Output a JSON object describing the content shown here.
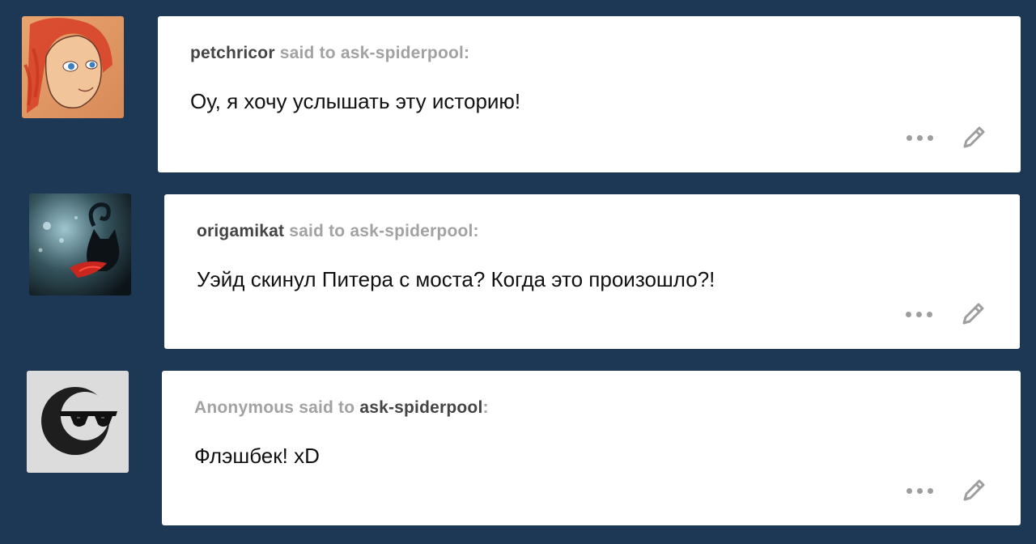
{
  "colors": {
    "background": "#1d3855",
    "card": "#ffffff",
    "username_strong": "#444444",
    "username_light": "#a2a2a2",
    "icon_gray": "#9e9e9e"
  },
  "asks": [
    {
      "asker": "petchricor",
      "said_to": "said to",
      "recipient": "ask-spiderpool",
      "colon": ":",
      "asker_anonymous": false,
      "question": "Оу, я хочу услышать эту историю!",
      "avatar_icon": "red-haired-character-drawing-avatar"
    },
    {
      "asker": "origamikat",
      "said_to": "said to",
      "recipient": "ask-spiderpool",
      "colon": ":",
      "asker_anonymous": false,
      "question": "Уэйд скинул Питера с моста? Когда это произошло?!",
      "avatar_icon": "black-cat-bubbles-avatar"
    },
    {
      "asker": "Anonymous",
      "said_to": "said to",
      "recipient": "ask-spiderpool",
      "colon": ":",
      "asker_anonymous": true,
      "question": "Флэшбек! xD",
      "avatar_icon": "anonymous-sunglasses-avatar"
    }
  ],
  "controls": {
    "more_icon": "more-dots-icon",
    "edit_icon": "pencil-icon"
  }
}
